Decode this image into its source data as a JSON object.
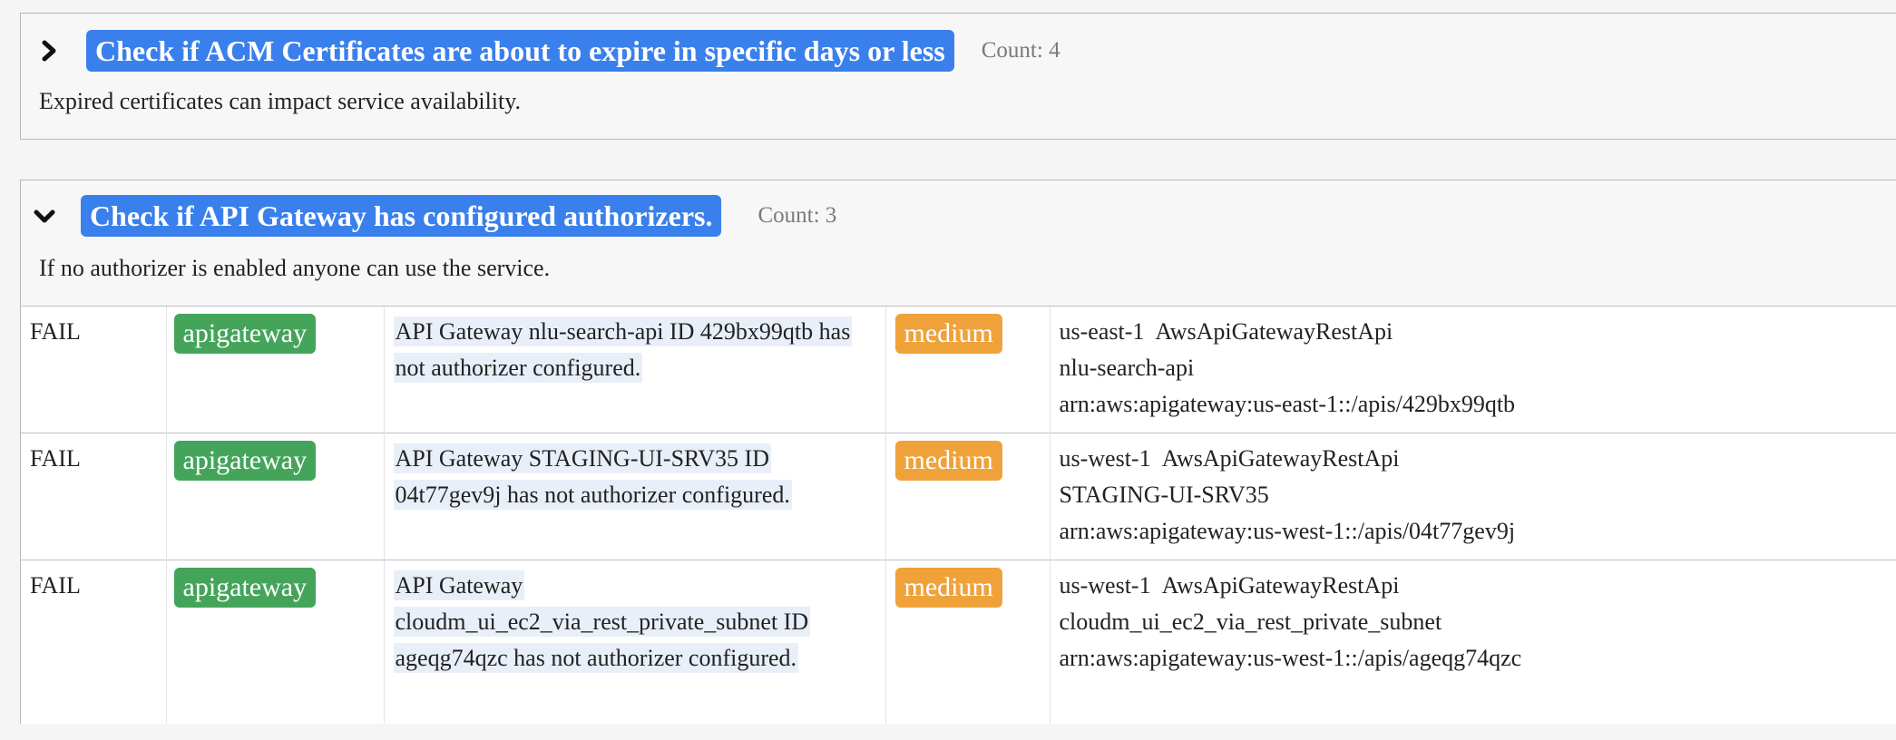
{
  "checks": [
    {
      "title": "Check if ACM Certificates are about to expire in specific days or less",
      "count": "Count: 4",
      "description": "Expired certificates can impact service availability.",
      "expanded": false
    },
    {
      "title": "Check if API Gateway has configured authorizers.",
      "count": "Count: 3",
      "description": "If no authorizer is enabled anyone can use the service.",
      "expanded": true,
      "findings": [
        {
          "status": "FAIL",
          "service": "apigateway",
          "message": "API Gateway nlu-search-api ID 429bx99qtb has not authorizer configured.",
          "severity": "medium",
          "region": "us-east-1",
          "resource_type": "AwsApiGatewayRestApi",
          "resource_name": "nlu-search-api",
          "arn": "arn:aws:apigateway:us-east-1::/apis/429bx99qtb"
        },
        {
          "status": "FAIL",
          "service": "apigateway",
          "message": "API Gateway STAGING-UI-SRV35 ID 04t77gev9j has not authorizer configured.",
          "severity": "medium",
          "region": "us-west-1",
          "resource_type": "AwsApiGatewayRestApi",
          "resource_name": "STAGING-UI-SRV35",
          "arn": "arn:aws:apigateway:us-west-1::/apis/04t77gev9j"
        },
        {
          "status": "FAIL",
          "service": "apigateway",
          "message": "API Gateway cloudm_ui_ec2_via_rest_private_subnet ID ageqg74qzc has not authorizer configured.",
          "severity": "medium",
          "region": "us-west-1",
          "resource_type": "AwsApiGatewayRestApi",
          "resource_name": "cloudm_ui_ec2_via_rest_private_subnet",
          "arn": "arn:aws:apigateway:us-west-1::/apis/ageqg74qzc"
        }
      ]
    }
  ],
  "icons": {
    "collapsed": "chevron-right-icon",
    "expanded": "chevron-down-icon"
  },
  "colors": {
    "title_bg": "#3a80ec",
    "service_bg": "#44a55a",
    "severity_bg": "#f0a23a",
    "message_highlight": "#e9eff9"
  }
}
